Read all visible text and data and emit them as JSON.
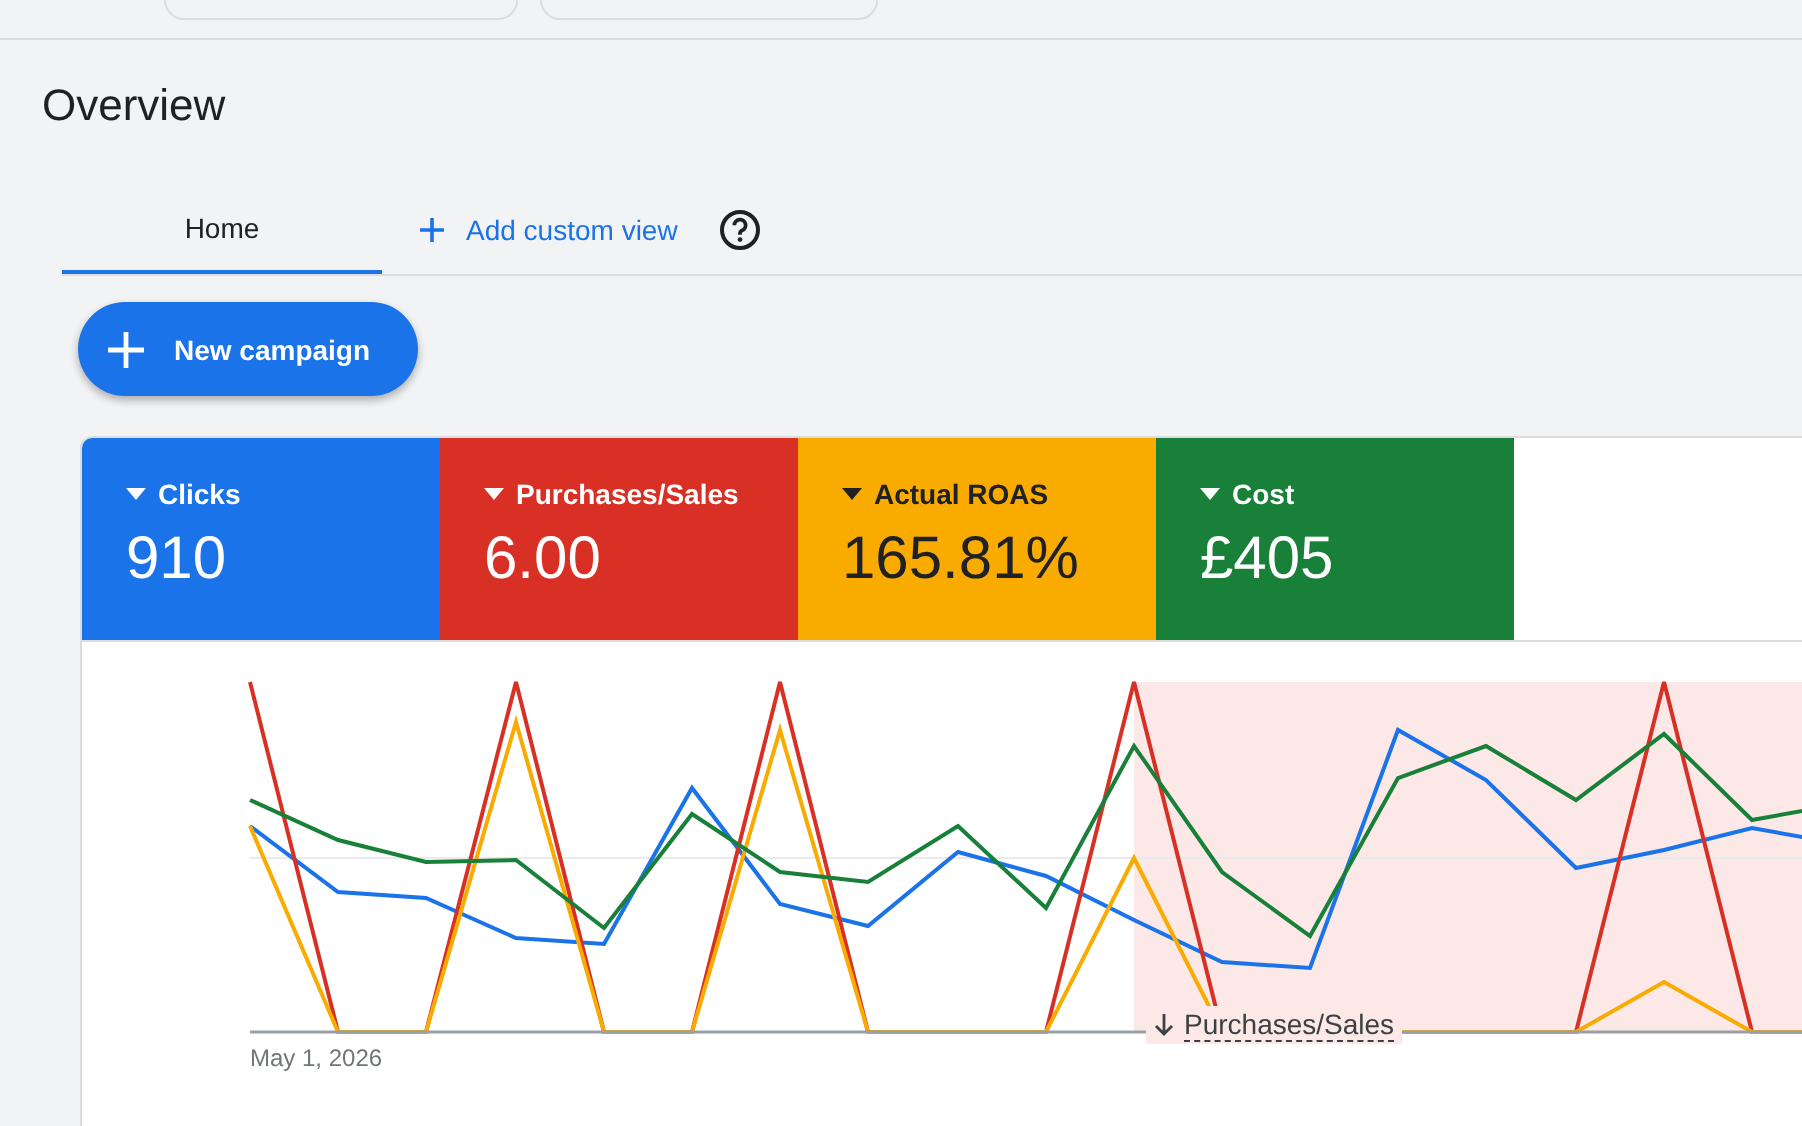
{
  "title": "Overview",
  "tabs": [
    {
      "label": "Home",
      "selected": true
    }
  ],
  "add_view": {
    "label": "Add custom view"
  },
  "new_campaign": {
    "label": "New campaign"
  },
  "metrics": [
    {
      "label": "Clicks",
      "value": "910",
      "color": "#1a73e8"
    },
    {
      "label": "Purchases/Sales",
      "value": "6.00",
      "color": "#d93025"
    },
    {
      "label": "Actual ROAS",
      "value": "165.81%",
      "color": "#f9ab00"
    },
    {
      "label": "Cost",
      "value": "£405",
      "color": "#188038"
    }
  ],
  "chart": {
    "x_label": "May 1, 2026",
    "annotation": "Purchases/Sales"
  }
}
